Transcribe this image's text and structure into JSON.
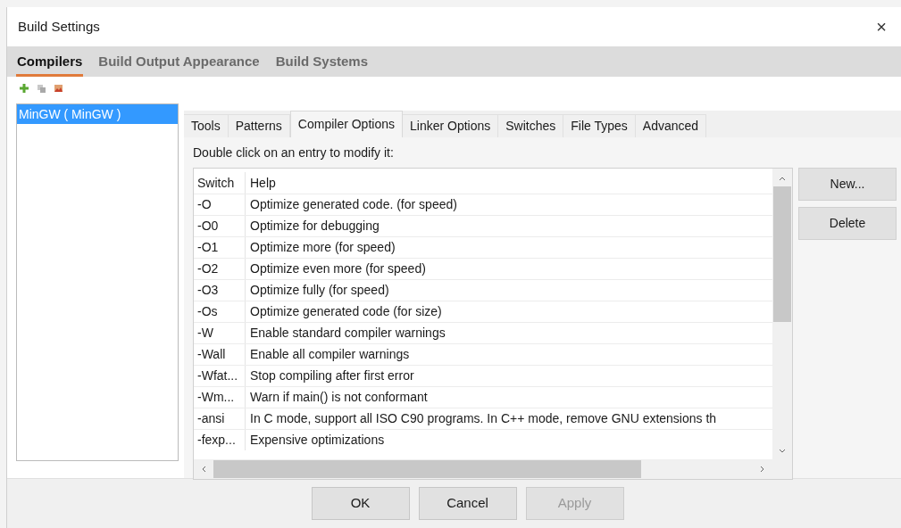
{
  "window": {
    "title": "Build Settings",
    "close": "×"
  },
  "tabs": [
    {
      "label": "Compilers",
      "selected": true
    },
    {
      "label": "Build Output Appearance",
      "selected": false
    },
    {
      "label": "Build Systems",
      "selected": false
    }
  ],
  "compilers": [
    {
      "label": "MinGW ( MinGW )",
      "selected": true
    }
  ],
  "option_tabs": [
    {
      "label": "Tools",
      "selected": false
    },
    {
      "label": "Patterns",
      "selected": false
    },
    {
      "label": "Compiler Options",
      "selected": true
    },
    {
      "label": "Linker Options",
      "selected": false
    },
    {
      "label": "Switches",
      "selected": false
    },
    {
      "label": "File Types",
      "selected": false
    },
    {
      "label": "Advanced",
      "selected": false
    }
  ],
  "hint": "Double click on an entry to modify it:",
  "table": {
    "columns": [
      "Switch",
      "Help"
    ],
    "rows": [
      [
        "-O",
        "Optimize generated code. (for speed)"
      ],
      [
        "-O0",
        "Optimize for debugging"
      ],
      [
        "-O1",
        "Optimize more (for speed)"
      ],
      [
        "-O2",
        "Optimize even more (for speed)"
      ],
      [
        "-O3",
        "Optimize fully (for speed)"
      ],
      [
        "-Os",
        "Optimize generated code (for size)"
      ],
      [
        "-W",
        "Enable standard compiler warnings"
      ],
      [
        "-Wall",
        "Enable all compiler warnings"
      ],
      [
        "-Wfat...",
        "Stop compiling after first error"
      ],
      [
        "-Wm...",
        "Warn if main() is not conformant"
      ],
      [
        "-ansi",
        "In C mode, support all ISO C90 programs. In C++ mode, remove GNU extensions th"
      ],
      [
        "-fexp...",
        "Expensive optimizations"
      ]
    ]
  },
  "side_buttons": [
    {
      "label": "New...",
      "disabled": false
    },
    {
      "label": "Delete",
      "disabled": false
    }
  ],
  "buttons": [
    {
      "label": "OK",
      "disabled": false
    },
    {
      "label": "Cancel",
      "disabled": false
    },
    {
      "label": "Apply",
      "disabled": true
    }
  ]
}
